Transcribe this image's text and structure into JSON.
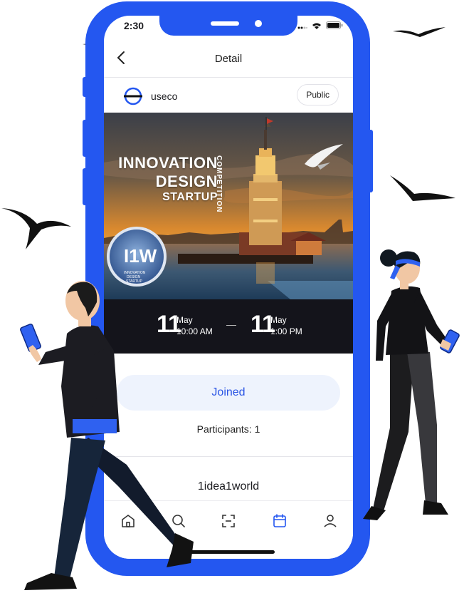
{
  "status_bar": {
    "time": "2:30",
    "icons": [
      "signal-icon",
      "wifi-icon",
      "battery-icon"
    ]
  },
  "nav": {
    "title": "Detail",
    "back_icon": "chevron-left-icon"
  },
  "organizer": {
    "name": "useco",
    "visibility": "Public"
  },
  "banner": {
    "line1": "INNOVATION",
    "line2": "DESIGN",
    "line3": "STARTUP",
    "vertical": "COMPETITION",
    "badge_caption1": "INNOVATION",
    "badge_caption2": "DESIGN",
    "badge_caption3": "STARTUP",
    "badge_mark": "I1W"
  },
  "event_dates": {
    "start": {
      "day": "11",
      "month": "May",
      "time": "10:00 AM"
    },
    "end": {
      "day": "11",
      "month": "May",
      "time": "1:00 PM"
    }
  },
  "actions": {
    "joined_label": "Joined"
  },
  "participants_text": "Participants: 1",
  "group_name": "1idea1world",
  "tabbar": {
    "items": [
      {
        "icon": "home-icon",
        "active": false
      },
      {
        "icon": "search-icon",
        "active": false
      },
      {
        "icon": "scan-icon",
        "active": false
      },
      {
        "icon": "calendar-icon",
        "active": true
      },
      {
        "icon": "profile-icon",
        "active": false
      }
    ]
  },
  "colors": {
    "brand_blue": "#2457f0",
    "joined_bg": "#eef3fd",
    "joined_text": "#2a55e5",
    "date_bar": "#14141b"
  }
}
